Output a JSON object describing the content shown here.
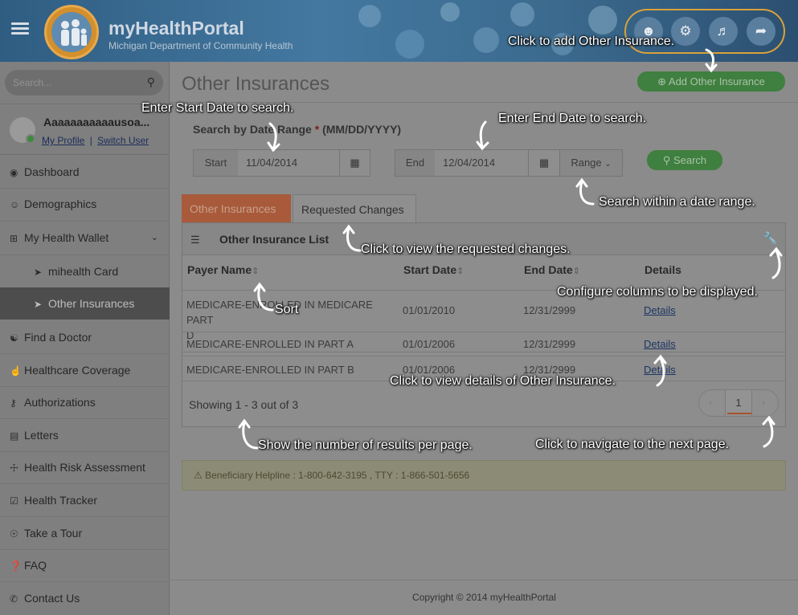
{
  "header": {
    "title": "myHealthPortal",
    "subtitle": "Michigan Department of Community Health",
    "icons": [
      "user-settings-icon",
      "gears-icon",
      "bell-icon",
      "sign-out-icon"
    ]
  },
  "sidebar": {
    "search_placeholder": "Search...",
    "user_name": "Aaaaaaaaaaausoa...",
    "my_profile": "My Profile",
    "separator": "|",
    "switch_user": "Switch User",
    "items": [
      {
        "label": "Dashboard",
        "icon": "dashboard-icon"
      },
      {
        "label": "Demographics",
        "icon": "users-icon"
      },
      {
        "label": "My Health Wallet",
        "icon": "plus-square-icon"
      },
      {
        "label": "mihealth Card",
        "icon": "circle-arrow-icon"
      },
      {
        "label": "Other Insurances",
        "icon": "circle-arrow-icon"
      },
      {
        "label": "Find a Doctor",
        "icon": "user-md-icon"
      },
      {
        "label": "Healthcare Coverage",
        "icon": "thumbs-up-icon"
      },
      {
        "label": "Authorizations",
        "icon": "key-icon"
      },
      {
        "label": "Letters",
        "icon": "file-icon"
      },
      {
        "label": "Health Risk Assessment",
        "icon": "medkit-icon"
      },
      {
        "label": "Health Tracker",
        "icon": "clipboard-icon"
      },
      {
        "label": "Take a Tour",
        "icon": "compass-icon"
      },
      {
        "label": "FAQ",
        "icon": "question-icon"
      },
      {
        "label": "Contact Us",
        "icon": "phone-icon"
      }
    ]
  },
  "main": {
    "page_title": "Other Insurances",
    "add_button": "Add Other Insurance",
    "search_label": "Search by Date Range",
    "required_mark": "*",
    "date_format": "(MM/DD/YYYY)",
    "start_label": "Start",
    "start_value": "11/04/2014",
    "end_label": "End",
    "end_value": "12/04/2014",
    "range_label": "Range",
    "search_button": "Search",
    "tabs": [
      "Other Insurances",
      "Requested Changes"
    ],
    "panel_title": "Other Insurance List",
    "columns": [
      "Payer Name",
      "Start Date",
      "End Date",
      "Details"
    ],
    "rows": [
      {
        "payer_line1": "MEDICARE-ENROLLED IN MEDICARE PART",
        "payer_line2": "D",
        "start": "01/01/2010",
        "end": "12/31/2999",
        "details": "Details"
      },
      {
        "payer_line1": "MEDICARE-ENROLLED IN PART A",
        "payer_line2": "",
        "start": "01/01/2006",
        "end": "12/31/2999",
        "details": "Details"
      },
      {
        "payer_line1": "MEDICARE-ENROLLED IN PART B",
        "payer_line2": "",
        "start": "01/01/2006",
        "end": "12/31/2999",
        "details": "Details"
      }
    ],
    "showing": "Showing 1 - 3 out of 3",
    "current_page": "1",
    "helpline": "Beneficiary Helpline : 1-800-642-3195 , TTY : 1-866-501-5656",
    "footer": "Copyright © 2014 myHealthPortal"
  },
  "annotations": {
    "add_other": "Click to add Other Insurance.",
    "start_date": "Enter Start Date to search.",
    "end_date": "Enter End Date to search.",
    "range": "Search within a date range.",
    "requested": "Click to view the requested changes.",
    "configure": "Configure columns to be displayed.",
    "sort": "Sort",
    "details": "Click to view details of Other Insurance.",
    "per_page": "Show the number of results per page.",
    "next_page": "Click to navigate to the next page."
  }
}
